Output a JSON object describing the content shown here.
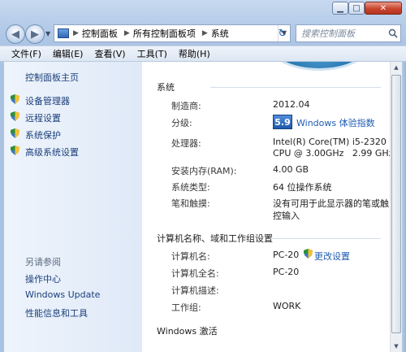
{
  "window": {
    "controls": {
      "minimize": "▁",
      "maximize": "□",
      "close": "✕"
    }
  },
  "nav": {
    "back_icon": "arrow-left-icon",
    "forward_icon": "arrow-right-icon",
    "breadcrumb": [
      "控制面板",
      "所有控制面板项",
      "系统"
    ],
    "search_placeholder": "搜索控制面板"
  },
  "menu": [
    "文件(F)",
    "编辑(E)",
    "查看(V)",
    "工具(T)",
    "帮助(H)"
  ],
  "sidebar": {
    "home": "控制面板主页",
    "items": [
      "设备管理器",
      "远程设置",
      "系统保护",
      "高级系统设置"
    ],
    "see_also_title": "另请参阅",
    "see_also": [
      "操作中心",
      "Windows Update",
      "性能信息和工具"
    ]
  },
  "system": {
    "section_title": "系统",
    "rows": [
      {
        "label": "制造商:",
        "value": "2012.04"
      },
      {
        "label": "分级:",
        "value": ""
      },
      {
        "label": "处理器:",
        "value": "Intel(R) Core(TM) i5-2320"
      },
      {
        "label": "",
        "value": "CPU @ 3.00GHz   2.99 GHz"
      },
      {
        "label": "安装内存(RAM):",
        "value": "4.00 GB"
      },
      {
        "label": "系统类型:",
        "value": "64 位操作系统"
      },
      {
        "label": "笔和触摸:",
        "value": "没有可用于此显示器的笔或触"
      },
      {
        "label": "",
        "value": "控输入"
      }
    ],
    "wei_score": "5.9",
    "wei_link": "Windows 体验指数"
  },
  "computer": {
    "section_title": "计算机名称、域和工作组设置",
    "rows": [
      {
        "label": "计算机名:",
        "value": "PC-20"
      },
      {
        "label": "计算机全名:",
        "value": "PC-20"
      },
      {
        "label": "计算机描述:",
        "value": ""
      },
      {
        "label": "工作组:",
        "value": "WORK"
      }
    ],
    "change_link": "更改设置"
  },
  "activation": {
    "section_title": "Windows 激活"
  }
}
